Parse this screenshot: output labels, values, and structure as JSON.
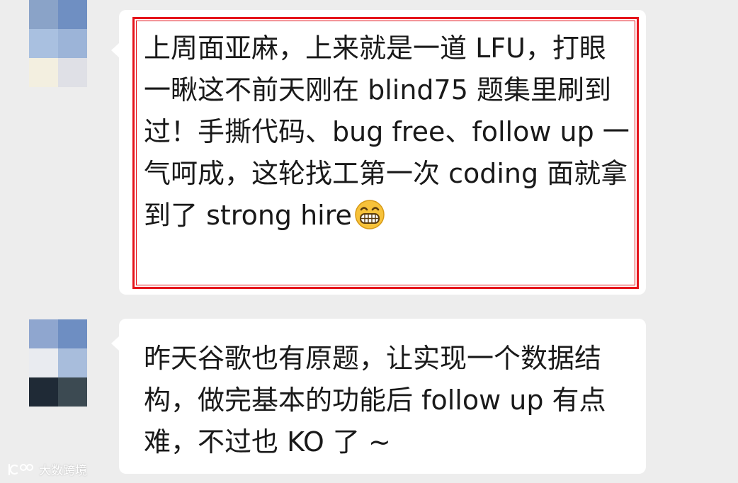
{
  "messages": [
    {
      "text": "上周面亚麻，上来就是一道 LFU，打眼一瞅这不前天刚在 blind75 题集里刷到过！手撕代码、bug free、follow up 一气呵成，这轮找工第一次 coding 面就拿到了 strong hire",
      "emoji": "grinning-face-emoji",
      "highlighted": true,
      "highlight_color": "#e5141b",
      "avatar_colors": [
        "#8aa3c8",
        "#6f8fc2",
        "#a9c0e0",
        "#9cb4d8",
        "#f3efe0",
        "#dfe0e6"
      ]
    },
    {
      "text": "昨天谷歌也有原题，让实现一个数据结构，做完基本的功能后 follow up 有点难，不过也 KO 了 ~",
      "highlighted": false,
      "avatar_colors": [
        "#8fa6cf",
        "#6e8ec2",
        "#e9ebf0",
        "#a8bddc",
        "#1f2a36",
        "#3c4a52"
      ]
    }
  ],
  "watermark": {
    "text": "大数跨境",
    "icon": "watermark-logo-icon"
  },
  "colors": {
    "background": "#ededed",
    "bubble": "#ffffff",
    "text": "#191919"
  }
}
